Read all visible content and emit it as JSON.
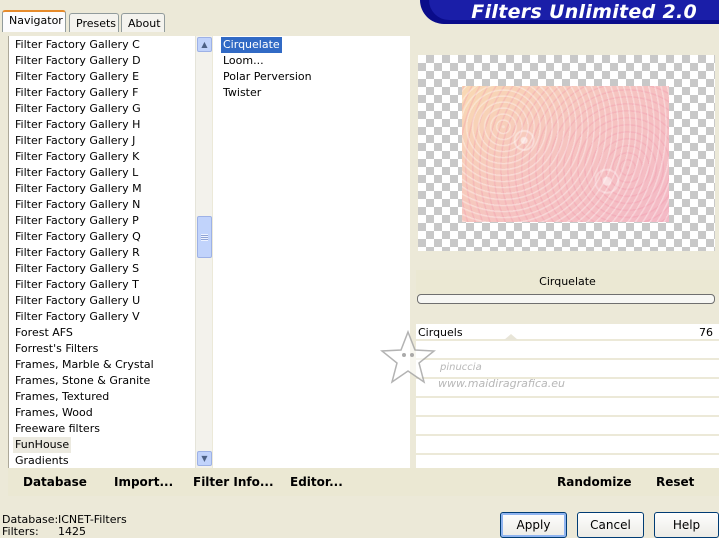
{
  "tabs": [
    {
      "label": "Navigator",
      "active": true
    },
    {
      "label": "Presets",
      "active": false
    },
    {
      "label": "About",
      "active": false
    }
  ],
  "banner": {
    "title": "Filters Unlimited 2.0"
  },
  "filter_categories": [
    "Filter Factory Gallery C",
    "Filter Factory Gallery D",
    "Filter Factory Gallery E",
    "Filter Factory Gallery F",
    "Filter Factory Gallery G",
    "Filter Factory Gallery H",
    "Filter Factory Gallery J",
    "Filter Factory Gallery K",
    "Filter Factory Gallery L",
    "Filter Factory Gallery M",
    "Filter Factory Gallery N",
    "Filter Factory Gallery P",
    "Filter Factory Gallery Q",
    "Filter Factory Gallery R",
    "Filter Factory Gallery S",
    "Filter Factory Gallery T",
    "Filter Factory Gallery U",
    "Filter Factory Gallery V",
    "Forest AFS",
    "Forrest's Filters",
    "Frames, Marble & Crystal",
    "Frames, Stone & Granite",
    "Frames, Textured",
    "Frames, Wood",
    "Freeware filters",
    "FunHouse",
    "Gradients"
  ],
  "selected_category": "FunHouse",
  "effects": [
    "Cirquelate",
    "Loom...",
    "Polar Perversion",
    "Twister"
  ],
  "selected_effect": "Cirquelate",
  "filter_name": "Cirquelate",
  "parameters": [
    {
      "label": "Cirquels",
      "value": "76",
      "fraction": 0.76
    }
  ],
  "watermark": {
    "line1": "pinuccia",
    "line2": "www.maidiragrafica.eu"
  },
  "toolbar": {
    "database": "Database",
    "import": "Import...",
    "filter_info": "Filter Info...",
    "editor": "Editor...",
    "randomize": "Randomize",
    "reset": "Reset"
  },
  "status": {
    "database_label": "Database:",
    "database_value": "ICNET-Filters",
    "filters_label": "Filters:",
    "filters_value": "1425"
  },
  "buttons": {
    "apply": "Apply",
    "cancel": "Cancel",
    "help": "Help"
  },
  "colors": {
    "selection": "#316ac5",
    "banner": "#1a1ea8",
    "face": "#ece9d8"
  }
}
